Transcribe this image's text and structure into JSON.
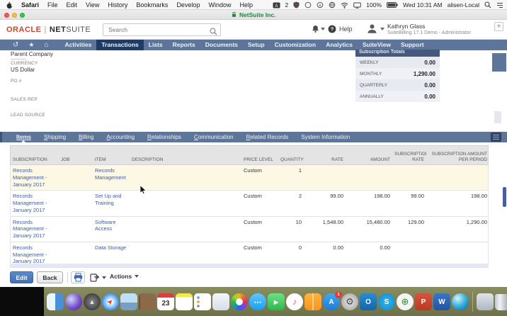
{
  "menubar": {
    "items": [
      "Safari",
      "File",
      "Edit",
      "View",
      "History",
      "Bookmarks",
      "Develop",
      "Window",
      "Help"
    ],
    "input_badge": "2",
    "battery": "100%",
    "clock": "Wed 10:31 AM",
    "device": "alisen-Local"
  },
  "titlebar": {
    "title": "NetSuite Inc."
  },
  "header": {
    "logo": {
      "oracle": "ORACLE",
      "divider": "|",
      "net": "NET",
      "suite": "SUITE"
    },
    "search_placeholder": "Search",
    "help": "Help",
    "user": {
      "name": "Kathryn Glass",
      "role": "SuiteBilling 17.1 Demo - Administrator"
    },
    "new_tab": "+"
  },
  "nav": {
    "icons": {
      "recents": "↺",
      "shortcuts": "★",
      "home": "⌂"
    },
    "items": [
      "Activities",
      "Transactions",
      "Lists",
      "Reports",
      "Documents",
      "Setup",
      "Customization",
      "Analytics",
      "SuiteView",
      "Support"
    ]
  },
  "form": {
    "parent_company": "Parent Company",
    "currency_label": "CURRENCY",
    "currency_value": "US Dollar",
    "po_label": "PO #",
    "sales_rep_label": "SALES REP",
    "lead_source_label": "LEAD SOURCE"
  },
  "totals": {
    "title": "Subscription Totals",
    "rows": [
      {
        "label": "WEEKLY",
        "value": "0.00"
      },
      {
        "label": "MONTHLY",
        "value": "1,290.00"
      },
      {
        "label": "QUARTERLY",
        "value": "0.00"
      },
      {
        "label": "ANNUALLY",
        "value": "0.00"
      }
    ]
  },
  "subtabs": {
    "items": [
      "Items",
      "Shipping",
      "Billing",
      "Accounting",
      "Relationships",
      "Communication",
      "Related Records",
      "System Information"
    ]
  },
  "table": {
    "columns": [
      "SUBSCRIPTION",
      "JOB",
      "ITEM",
      "DESCRIPTION",
      "PRICE LEVEL",
      "QUANTITY",
      "RATE",
      "AMOUNT",
      "SUBSCRIPTION RATE",
      "SUBSCRIPTION AMOUNT PER PERIOD"
    ],
    "rows": [
      {
        "sub": "Records Management - January 2017",
        "job": "",
        "item": "Records Management",
        "desc": "",
        "level": "Custom",
        "qty": "1",
        "rate": "",
        "amount": "",
        "srate": "",
        "samount": ""
      },
      {
        "sub": "Records Management - January 2017",
        "job": "",
        "item": "Set Up and Training",
        "desc": "",
        "level": "Custom",
        "qty": "2",
        "rate": "99.00",
        "amount": "198.00",
        "srate": "99.00",
        "samount": "198.00"
      },
      {
        "sub": "Records Management - January 2017",
        "job": "",
        "item": "Software Access",
        "desc": "",
        "level": "Custom",
        "qty": "10",
        "rate": "1,548.00",
        "amount": "15,480.00",
        "srate": "129.00",
        "samount": "1,290.00"
      },
      {
        "sub": "Records Management - January 2017",
        "job": "",
        "item": "Data Storage",
        "desc": "",
        "level": "Custom",
        "qty": "0",
        "rate": "0.00",
        "amount": "0.00",
        "srate": "",
        "samount": ""
      }
    ]
  },
  "footer": {
    "edit": "Edit",
    "back": "Back",
    "actions": "Actions"
  },
  "dock": {
    "app_store_badge": "1",
    "icons": [
      {
        "name": "finder",
        "glyph": ""
      },
      {
        "name": "siri",
        "glyph": ""
      },
      {
        "name": "launchpad",
        "glyph": "▲"
      },
      {
        "name": "safari",
        "glyph": "➤"
      },
      {
        "name": "preview",
        "glyph": ""
      },
      {
        "name": "contacts",
        "glyph": ""
      },
      {
        "name": "calendar",
        "glyph": "23"
      },
      {
        "name": "notes",
        "glyph": ""
      },
      {
        "name": "reminders",
        "glyph": ""
      },
      {
        "name": "image-capture",
        "glyph": ""
      },
      {
        "name": "photos",
        "glyph": ""
      },
      {
        "name": "messages",
        "glyph": "⋯"
      },
      {
        "name": "facetime",
        "glyph": "▶"
      },
      {
        "name": "itunes",
        "glyph": "♪"
      },
      {
        "name": "books",
        "glyph": ""
      },
      {
        "name": "app-store",
        "glyph": "A"
      },
      {
        "name": "system-preferences",
        "glyph": "⚙"
      },
      {
        "name": "outlook",
        "glyph": "O"
      },
      {
        "name": "skype",
        "glyph": "S"
      },
      {
        "name": "anyconnect",
        "glyph": "⊕"
      },
      {
        "name": "powerpoint",
        "glyph": "P"
      },
      {
        "name": "word",
        "glyph": "W"
      },
      {
        "name": "teamviewer",
        "glyph": ""
      },
      {
        "name": "downloads",
        "glyph": ""
      },
      {
        "name": "trash",
        "glyph": ""
      }
    ]
  },
  "colors": {
    "nav_bar": "#5d7599",
    "nav_active": "#1f3a64",
    "subtab_bar": "#5d7599",
    "totals_header": "#44597c",
    "highlight_row": "#fcf8e3",
    "link_blue": "#3e5ca8",
    "oracle_red": "#c74634",
    "edit_button": "#4272b4"
  }
}
